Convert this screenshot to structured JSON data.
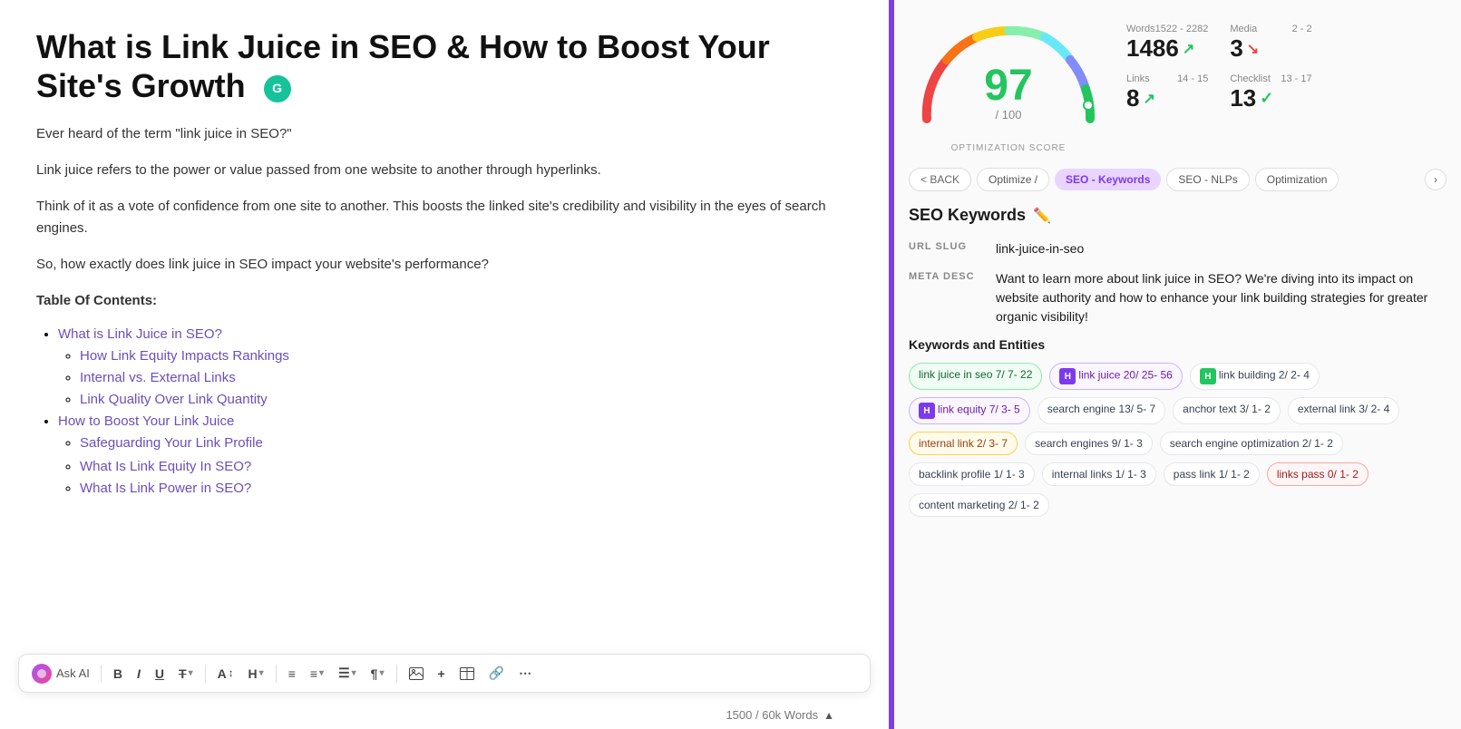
{
  "editor": {
    "title": "What is Link Juice in SEO & How to Boost Your Site's Growth",
    "intro_1": "Ever heard of the term \"link juice in SEO?\"",
    "intro_2": "Link juice refers to the power or value passed from one website to another through hyperlinks.",
    "intro_3": "Think of it as a vote of confidence from one site to another. This boosts the linked site's credibility and visibility in the eyes of search engines.",
    "intro_4": "So, how exactly does link juice in SEO impact your website's performance?",
    "toc_title": "Table Of Contents:",
    "toc_items": [
      {
        "label": "What is Link Juice in SEO?",
        "children": [
          "How Link Equity Impacts Rankings",
          "Internal vs. External Links",
          "Link Quality Over Link Quantity"
        ]
      },
      {
        "label": "How to Boost Your Link Juice",
        "children": [
          "Safeguarding Your Link Profile"
        ]
      }
    ],
    "more_toc": [
      "What Is Link Equity In SEO?",
      "What Is Link Power in SEO?"
    ],
    "word_count": "1500 / 60k Words"
  },
  "toolbar": {
    "ask_ai": "Ask AI",
    "bold": "B",
    "italic": "I",
    "underline": "U",
    "strikethrough": "T",
    "font_size": "A",
    "heading": "H",
    "align": "≡",
    "list_ordered": "≡",
    "list_unordered": "≡",
    "paragraph": "¶",
    "image": "⊞",
    "plus": "+",
    "table": "⊞",
    "link": "⛓",
    "more": "⋯"
  },
  "score": {
    "value": 97,
    "denom": "/ 100",
    "label": "OPTIMIZATION SCORE",
    "words_label": "Words",
    "words_range": "1522 - 2282",
    "words_value": "1486",
    "words_arrow": "up",
    "media_label": "Media",
    "media_range": "2 - 2",
    "media_value": "3",
    "media_arrow": "down",
    "links_label": "Links",
    "links_range": "14 - 15",
    "links_value": "8",
    "links_arrow": "up",
    "checklist_label": "Checklist",
    "checklist_range": "13 - 17",
    "checklist_value": "13",
    "checklist_check": true
  },
  "tabs": {
    "back": "< BACK",
    "items": [
      {
        "label": "Optimize /",
        "active": true
      },
      {
        "label": "SEO - Keywords",
        "active": true
      },
      {
        "label": "SEO - NLPs",
        "active": false
      },
      {
        "label": "Optimization",
        "active": false
      }
    ]
  },
  "seo": {
    "title": "SEO Keywords",
    "url_slug_label": "URL SLUG",
    "url_slug_value": "link-juice-in-seo",
    "meta_desc_label": "META DESC",
    "meta_desc_value": "Want to learn more about link juice in SEO? We're diving into its impact on website authority and how to enhance your link building strategies for greater organic visibility!",
    "keywords_title": "Keywords and Entities",
    "keywords": [
      {
        "label": "link juice in seo",
        "counts": "7/ 7- 22",
        "type": "green"
      },
      {
        "label": "link juice",
        "counts": "20/ 25- 56",
        "badge": "H",
        "badge_color": "purple",
        "type": "purple"
      },
      {
        "label": "link building",
        "counts": "2/ 2- 4",
        "badge": "H",
        "badge_color": "green",
        "type": "default"
      },
      {
        "label": "link equity",
        "counts": "7/ 3- 5",
        "badge": "H",
        "badge_color": "purple",
        "type": "purple"
      },
      {
        "label": "search engine",
        "counts": "13/ 5- 7",
        "type": "default"
      },
      {
        "label": "anchor text",
        "counts": "3/ 1- 2",
        "type": "default"
      },
      {
        "label": "external link",
        "counts": "3/ 2- 4",
        "type": "default"
      },
      {
        "label": "internal link",
        "counts": "2/ 3- 7",
        "type": "orange"
      },
      {
        "label": "search engines",
        "counts": "9/ 1- 3",
        "type": "default"
      },
      {
        "label": "search engine optimization",
        "counts": "2/ 1- 2",
        "type": "default"
      },
      {
        "label": "backlink profile",
        "counts": "1/ 1- 3",
        "type": "default"
      },
      {
        "label": "internal links",
        "counts": "1/ 1- 3",
        "type": "default"
      },
      {
        "label": "pass link",
        "counts": "1/ 1- 2",
        "type": "default"
      },
      {
        "label": "links pass",
        "counts": "0/ 1- 2",
        "type": "red"
      },
      {
        "label": "content marketing",
        "counts": "2/ 1- 2",
        "type": "default"
      }
    ]
  }
}
